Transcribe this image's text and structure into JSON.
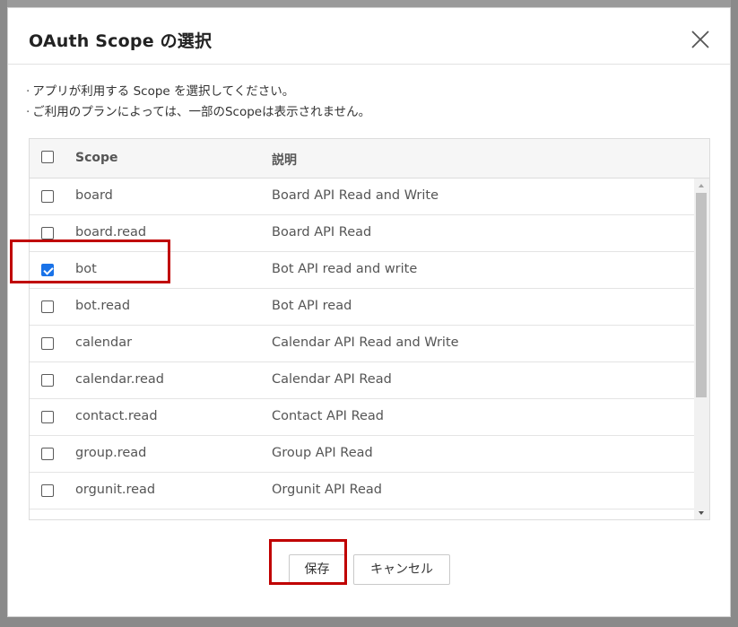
{
  "dialog": {
    "title": "OAuth Scope の選択",
    "close_icon": "close-icon",
    "notes": [
      "アプリが利用する Scope を選択してください。",
      "ご利用のプランによっては、一部のScopeは表示されません。"
    ],
    "note_bullet": "·"
  },
  "table": {
    "headers": {
      "scope": "Scope",
      "description": "説明"
    },
    "select_all_checked": false,
    "rows": [
      {
        "scope": "board",
        "description": "Board API Read and Write",
        "checked": false
      },
      {
        "scope": "board.read",
        "description": "Board API Read",
        "checked": false
      },
      {
        "scope": "bot",
        "description": "Bot API read and write",
        "checked": true
      },
      {
        "scope": "bot.read",
        "description": "Bot API read",
        "checked": false
      },
      {
        "scope": "calendar",
        "description": "Calendar API Read and Write",
        "checked": false
      },
      {
        "scope": "calendar.read",
        "description": "Calendar API Read",
        "checked": false
      },
      {
        "scope": "contact.read",
        "description": "Contact API Read",
        "checked": false
      },
      {
        "scope": "group.read",
        "description": "Group API Read",
        "checked": false
      },
      {
        "scope": "orgunit.read",
        "description": "Orgunit API Read",
        "checked": false
      },
      {
        "scope": "",
        "description": "",
        "checked": false
      }
    ]
  },
  "footer": {
    "save_label": "保存",
    "cancel_label": "キャンセル"
  },
  "colors": {
    "highlight": "#c00000",
    "checkbox_checked": "#1a73e8",
    "overlay": "#7f7f7f"
  }
}
